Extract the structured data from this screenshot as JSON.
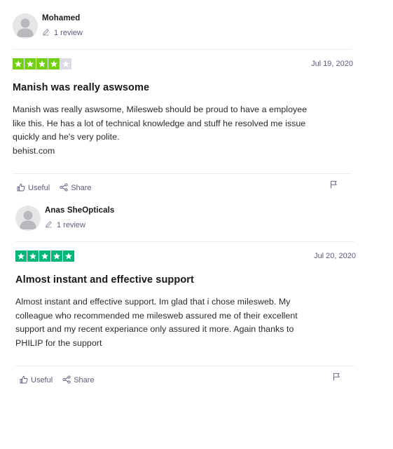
{
  "reviews": [
    {
      "name": "Mohamed",
      "review_count": "1 review",
      "rating": 4,
      "star_color": "#73cf11",
      "date": "Jul 19, 2020",
      "title": "Manish was really aswsome",
      "body_lines": [
        "Manish was really aswsome, Milesweb should be proud to have a employee",
        "like this. He has a lot of technical knowledge and stuff he resolved me issue",
        "quickly and he's very polite.",
        "behist.com"
      ],
      "useful_label": "Useful",
      "share_label": "Share"
    },
    {
      "name": "Anas SheOpticals",
      "review_count": "1 review",
      "rating": 5,
      "star_color": "#00b67a",
      "date": "Jul 20, 2020",
      "title": "Almost instant and effective support",
      "body_lines": [
        "Almost instant and effective support. Im glad that i chose milesweb. My",
        "colleague who recommended me milesweb assured me of their excellent",
        "support and my recent experiance only assured it more. Again thanks to",
        "PHILIP for the support"
      ],
      "useful_label": "Useful",
      "share_label": "Share"
    }
  ],
  "colors": {
    "empty_star": "#dcdce6",
    "muted_text": "#5b5b7b"
  },
  "icons": {
    "avatar": "avatar-icon",
    "review_count": "pencil-icon",
    "useful": "thumbs-up-icon",
    "share": "share-icon",
    "report": "flag-icon",
    "rating": "star-icon"
  }
}
